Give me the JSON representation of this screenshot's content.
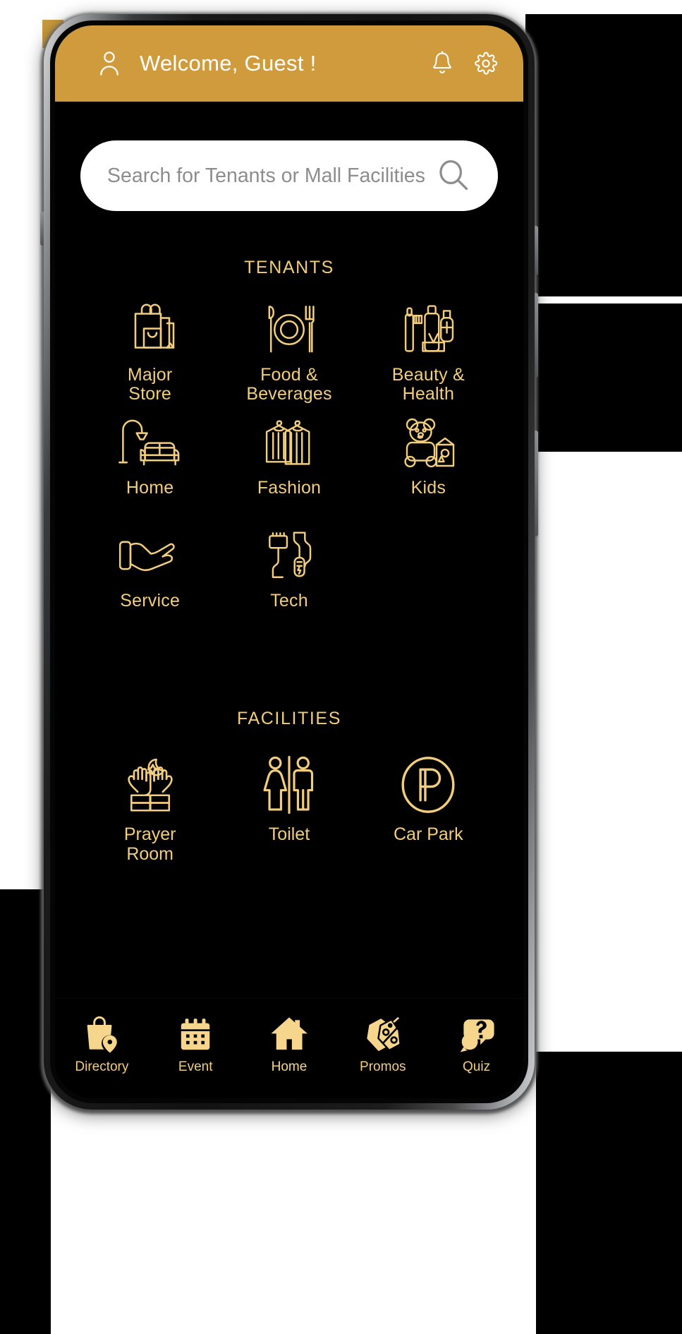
{
  "theme": {
    "gold": "#f2cd7e",
    "header_gold": "#cf9b3c",
    "background": "#000000",
    "search_background": "#ffffff"
  },
  "header": {
    "profile_icon": "person-icon",
    "greeting": "Welcome, Guest !",
    "notification_icon": "bell-icon",
    "settings_icon": "gear-icon"
  },
  "search": {
    "placeholder": "Search for Tenants or Mall Facilities",
    "value": "",
    "icon": "search-icon"
  },
  "tenants": {
    "title": "TENANTS",
    "items": [
      {
        "label": "Major\nStore",
        "line1": "Major",
        "line2": "Store",
        "icon": "shopping-bags-icon"
      },
      {
        "label": "Food &\nBeverages",
        "line1": "Food &",
        "line2": "Beverages",
        "icon": "plate-cutlery-icon"
      },
      {
        "label": "Beauty &\nHealth",
        "line1": "Beauty &",
        "line2": "Health",
        "icon": "cosmetics-icon"
      },
      {
        "label": "Home",
        "line1": "Home",
        "line2": "",
        "icon": "sofa-lamp-icon"
      },
      {
        "label": "Fashion",
        "line1": "Fashion",
        "line2": "",
        "icon": "clothes-hanger-icon"
      },
      {
        "label": "Kids",
        "line1": "Kids",
        "line2": "",
        "icon": "teddy-bear-icon"
      },
      {
        "label": "Service",
        "line1": "Service",
        "line2": "",
        "icon": "open-hand-icon"
      },
      {
        "label": "Tech",
        "line1": "Tech",
        "line2": "",
        "icon": "cable-connector-icon"
      }
    ]
  },
  "facilities": {
    "title": "FACILITIES",
    "items": [
      {
        "label": "Prayer\nRoom",
        "line1": "Prayer",
        "line2": "Room",
        "icon": "praying-hands-icon"
      },
      {
        "label": "Toilet",
        "line1": "Toilet",
        "line2": "",
        "icon": "restroom-icon"
      },
      {
        "label": "Car Park",
        "line1": "Car Park",
        "line2": "",
        "icon": "parking-p-icon"
      }
    ]
  },
  "bottom_nav": {
    "active": "Home",
    "items": [
      {
        "label": "Directory",
        "icon": "shopping-bag-pin-icon"
      },
      {
        "label": "Event",
        "icon": "calendar-icon"
      },
      {
        "label": "Home",
        "icon": "house-icon"
      },
      {
        "label": "Promos",
        "icon": "discount-tags-icon"
      },
      {
        "label": "Quiz",
        "icon": "question-bubble-icon"
      }
    ]
  }
}
